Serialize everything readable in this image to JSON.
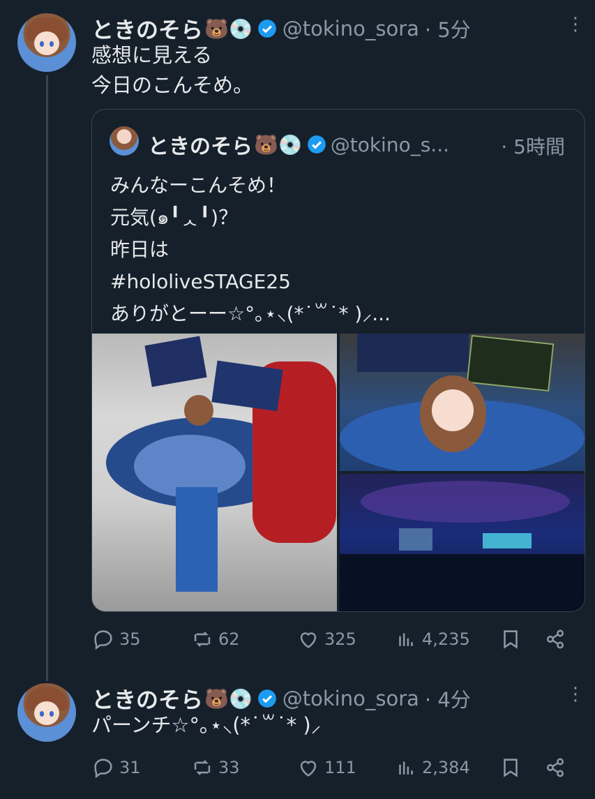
{
  "tweets": [
    {
      "name": "ときのそら",
      "emojis": "🐻💿",
      "handle": "@tokino_sora",
      "time": "· 5分",
      "text": "感想に見える\n今日のこんそめ。",
      "quote": {
        "name": "ときのそら",
        "emojis": "🐻💿",
        "handle": "@tokino_s...",
        "time": "· 5時間",
        "text": "みんなーこんそめ！\n元気(๑╹ᆺ╹)？\n昨日は\n #hololiveSTAGE25\nありがとーー☆°｡⋆⸜(*˙꒳˙* )⸝..."
      },
      "stats": {
        "replies": "35",
        "retweets": "62",
        "likes": "325",
        "views": "4,235"
      }
    },
    {
      "name": "ときのそら",
      "emojis": "🐻💿",
      "handle": "@tokino_sora",
      "time": "· 4分",
      "text": "パーンチ☆°｡⋆⸜(*˙꒳˙* )⸝",
      "stats": {
        "replies": "31",
        "retweets": "33",
        "likes": "111",
        "views": "2,384"
      }
    }
  ],
  "colors": {
    "background": "#15202b",
    "verified": "#1d9bf0",
    "muted": "#8b98a5",
    "border": "#38444d"
  },
  "icons": [
    "more-icon",
    "verified-icon",
    "reply-icon",
    "retweet-icon",
    "like-icon",
    "views-icon",
    "bookmark-icon",
    "share-icon"
  ]
}
